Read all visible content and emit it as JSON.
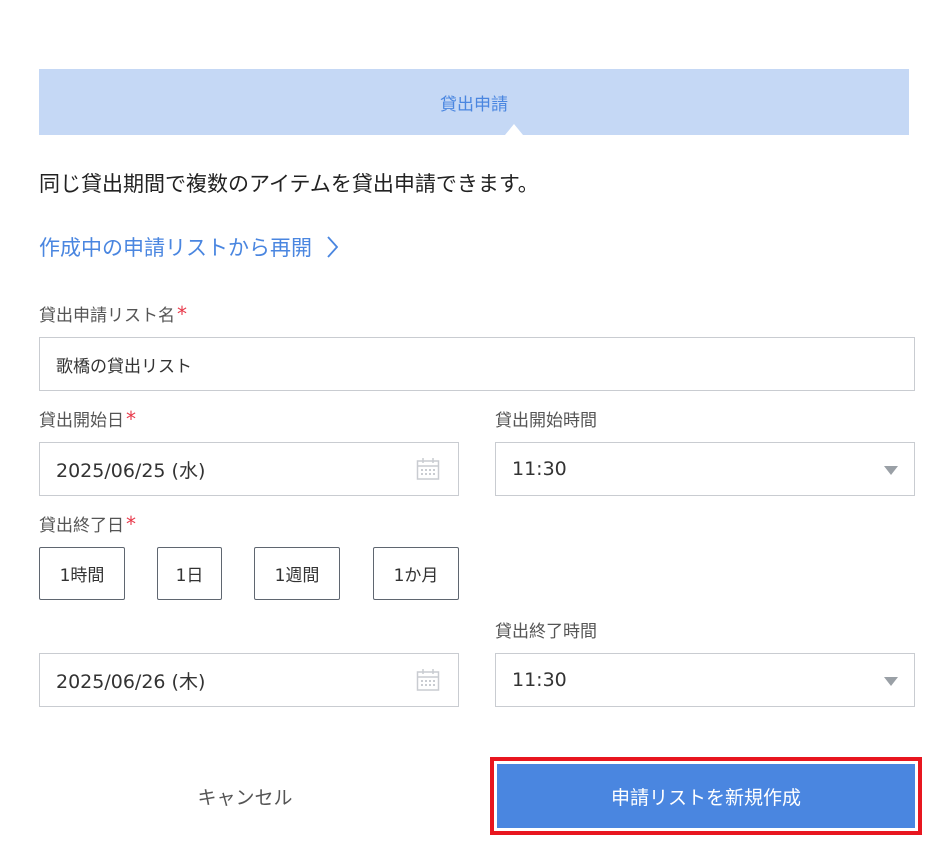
{
  "header": {
    "tab_label": "貸出申請"
  },
  "description": "同じ貸出期間で複数のアイテムを貸出申請できます。",
  "resume_link": {
    "label": "作成中の申請リストから再開"
  },
  "list_name": {
    "label": "貸出申請リスト名",
    "required_mark": "*",
    "value": "歌橋の貸出リスト"
  },
  "start_date": {
    "label": "貸出開始日",
    "required_mark": "*",
    "value": "2025/06/25 (水)"
  },
  "start_time": {
    "label": "貸出開始時間",
    "value": "11:30"
  },
  "end_date": {
    "label": "貸出終了日",
    "required_mark": "*",
    "value": "2025/06/26 (木)"
  },
  "quick_buttons": [
    {
      "label": "1時間"
    },
    {
      "label": "1日"
    },
    {
      "label": "1週間"
    },
    {
      "label": "1か月"
    }
  ],
  "end_time": {
    "label": "貸出終了時間",
    "value": "11:30"
  },
  "actions": {
    "cancel_label": "キャンセル",
    "create_label": "申請リストを新規作成"
  },
  "colors": {
    "accent": "#4a86e0",
    "header_bg": "#c5d8f5",
    "required": "#e8394a",
    "highlight_border": "#e8161f"
  }
}
